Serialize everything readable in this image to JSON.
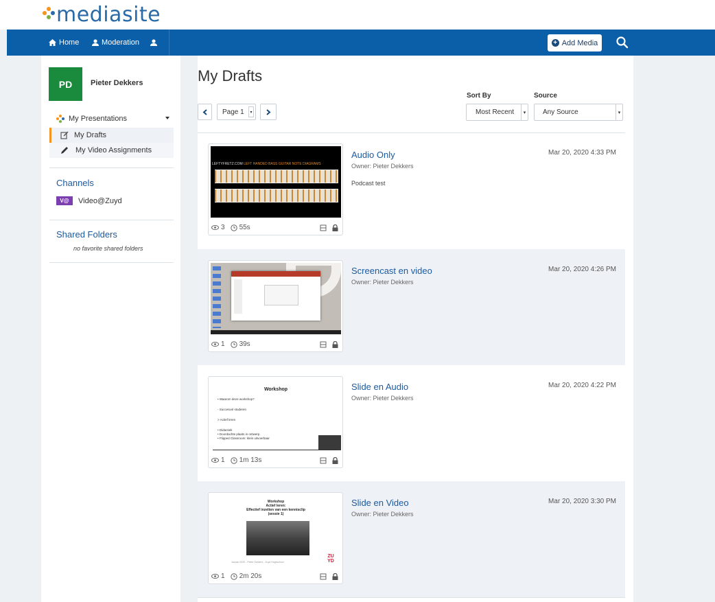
{
  "brand": {
    "logo_text": "mediasite",
    "accent": "#f7941d",
    "nav_color": "#0b5ea8"
  },
  "nav": {
    "home_label": "Home",
    "moderation_label": "Moderation",
    "add_media_label": "Add Media"
  },
  "user": {
    "initials": "PD",
    "name": "Pieter Dekkers"
  },
  "sidebar": {
    "presentations_label": "My Presentations",
    "drafts_label": "My Drafts",
    "assignments_label": "My Video Assignments",
    "channels_title": "Channels",
    "channel_badge": "V@",
    "channel_name": "Video@Zuyd",
    "shared_title": "Shared Folders",
    "shared_empty": "no favorite shared folders"
  },
  "main": {
    "title": "My Drafts",
    "page_label": "Page 1",
    "sort_by_label": "Sort By",
    "sort_value": "Most Recent",
    "source_label": "Source",
    "source_value": "Any Source"
  },
  "items": [
    {
      "title": "Audio Only",
      "owner": "Owner: Pieter Dekkers",
      "description": "Podcast test",
      "date": "Mar 20, 2020 4:33 PM",
      "views": "3",
      "duration": "55s"
    },
    {
      "title": "Screencast en video",
      "owner": "Owner: Pieter Dekkers",
      "description": "",
      "date": "Mar 20, 2020 4:26 PM",
      "views": "1",
      "duration": "39s"
    },
    {
      "title": "Slide en Audio",
      "owner": "Owner: Pieter Dekkers",
      "description": "",
      "date": "Mar 20, 2020 4:22 PM",
      "views": "1",
      "duration": "1m 13s"
    },
    {
      "title": "Slide en Video",
      "owner": "Owner: Pieter Dekkers",
      "description": "",
      "date": "Mar 20, 2020 3:30 PM",
      "views": "1",
      "duration": "2m 20s"
    }
  ],
  "thumbs": {
    "audio_banner": "LEFTYFRETZ.COM",
    "audio_banner2": "LEFT HANDED BASS GUITAR NOTE DIAGRAMS",
    "slide3_title": "Workshop",
    "slide3_bullets": [
      "• Waarom deze workshop?",
      "- Succesvol studeren",
      "> Actief leren",
      "• Didactiek",
      "• Doordachte plaats in ontwerp",
      "• Flipped Classroom: klein uitvoerbaar"
    ],
    "slide4_title": "Workshop",
    "slide4_sub1": "Actief leren:",
    "slide4_sub2": "Effectief inzetten van een kennisclip",
    "slide4_sub3": "(sessie 1)",
    "slide4_logo": "ZU YD",
    "slide4_footer": "Januari 2020 - Pieter Dekkers - Zuyd Hogeschool"
  }
}
